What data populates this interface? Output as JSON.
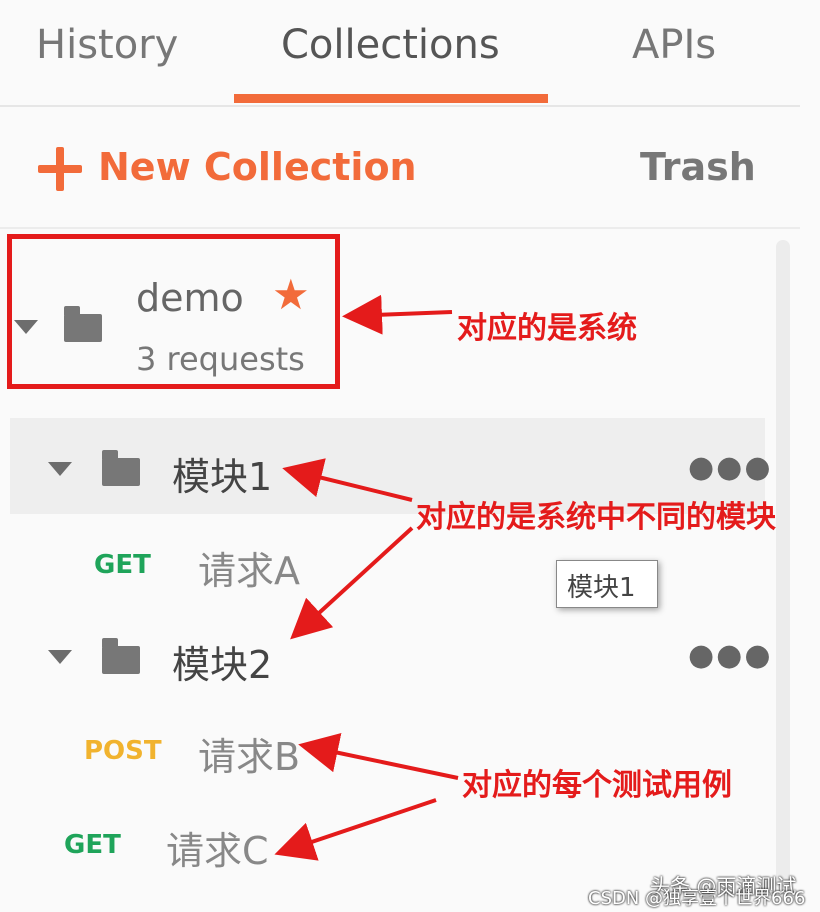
{
  "tabs": {
    "history": "History",
    "collections": "Collections",
    "apis": "APIs",
    "active": "Collections"
  },
  "toolbar": {
    "new_collection": "New Collection",
    "trash": "Trash"
  },
  "collection": {
    "name": "demo",
    "requests_count": "3 requests",
    "starred": true
  },
  "folders": [
    {
      "label": "模块1",
      "requests": [
        {
          "method": "GET",
          "label": "请求A"
        }
      ]
    },
    {
      "label": "模块2",
      "requests": [
        {
          "method": "POST",
          "label": "请求B"
        },
        {
          "method": "GET",
          "label": "请求C"
        }
      ]
    }
  ],
  "tooltip": "模块1",
  "annotations": {
    "system": "对应的是系统",
    "module": "对应的是系统中不同的模块",
    "testcase": "对应的每个测试用例"
  },
  "watermark": {
    "line1": "头条 @雨滴测试",
    "line2": "CSDN @独享壹个世界666"
  },
  "colors": {
    "accent": "#f26b3a",
    "get": "#1fa45a",
    "post": "#f1b32e",
    "annotation": "#e41b1b"
  },
  "icons": {
    "star": "star-icon",
    "folder": "folder-icon",
    "caret": "caret-down-icon",
    "more": "more-icon",
    "plus": "plus-icon"
  }
}
